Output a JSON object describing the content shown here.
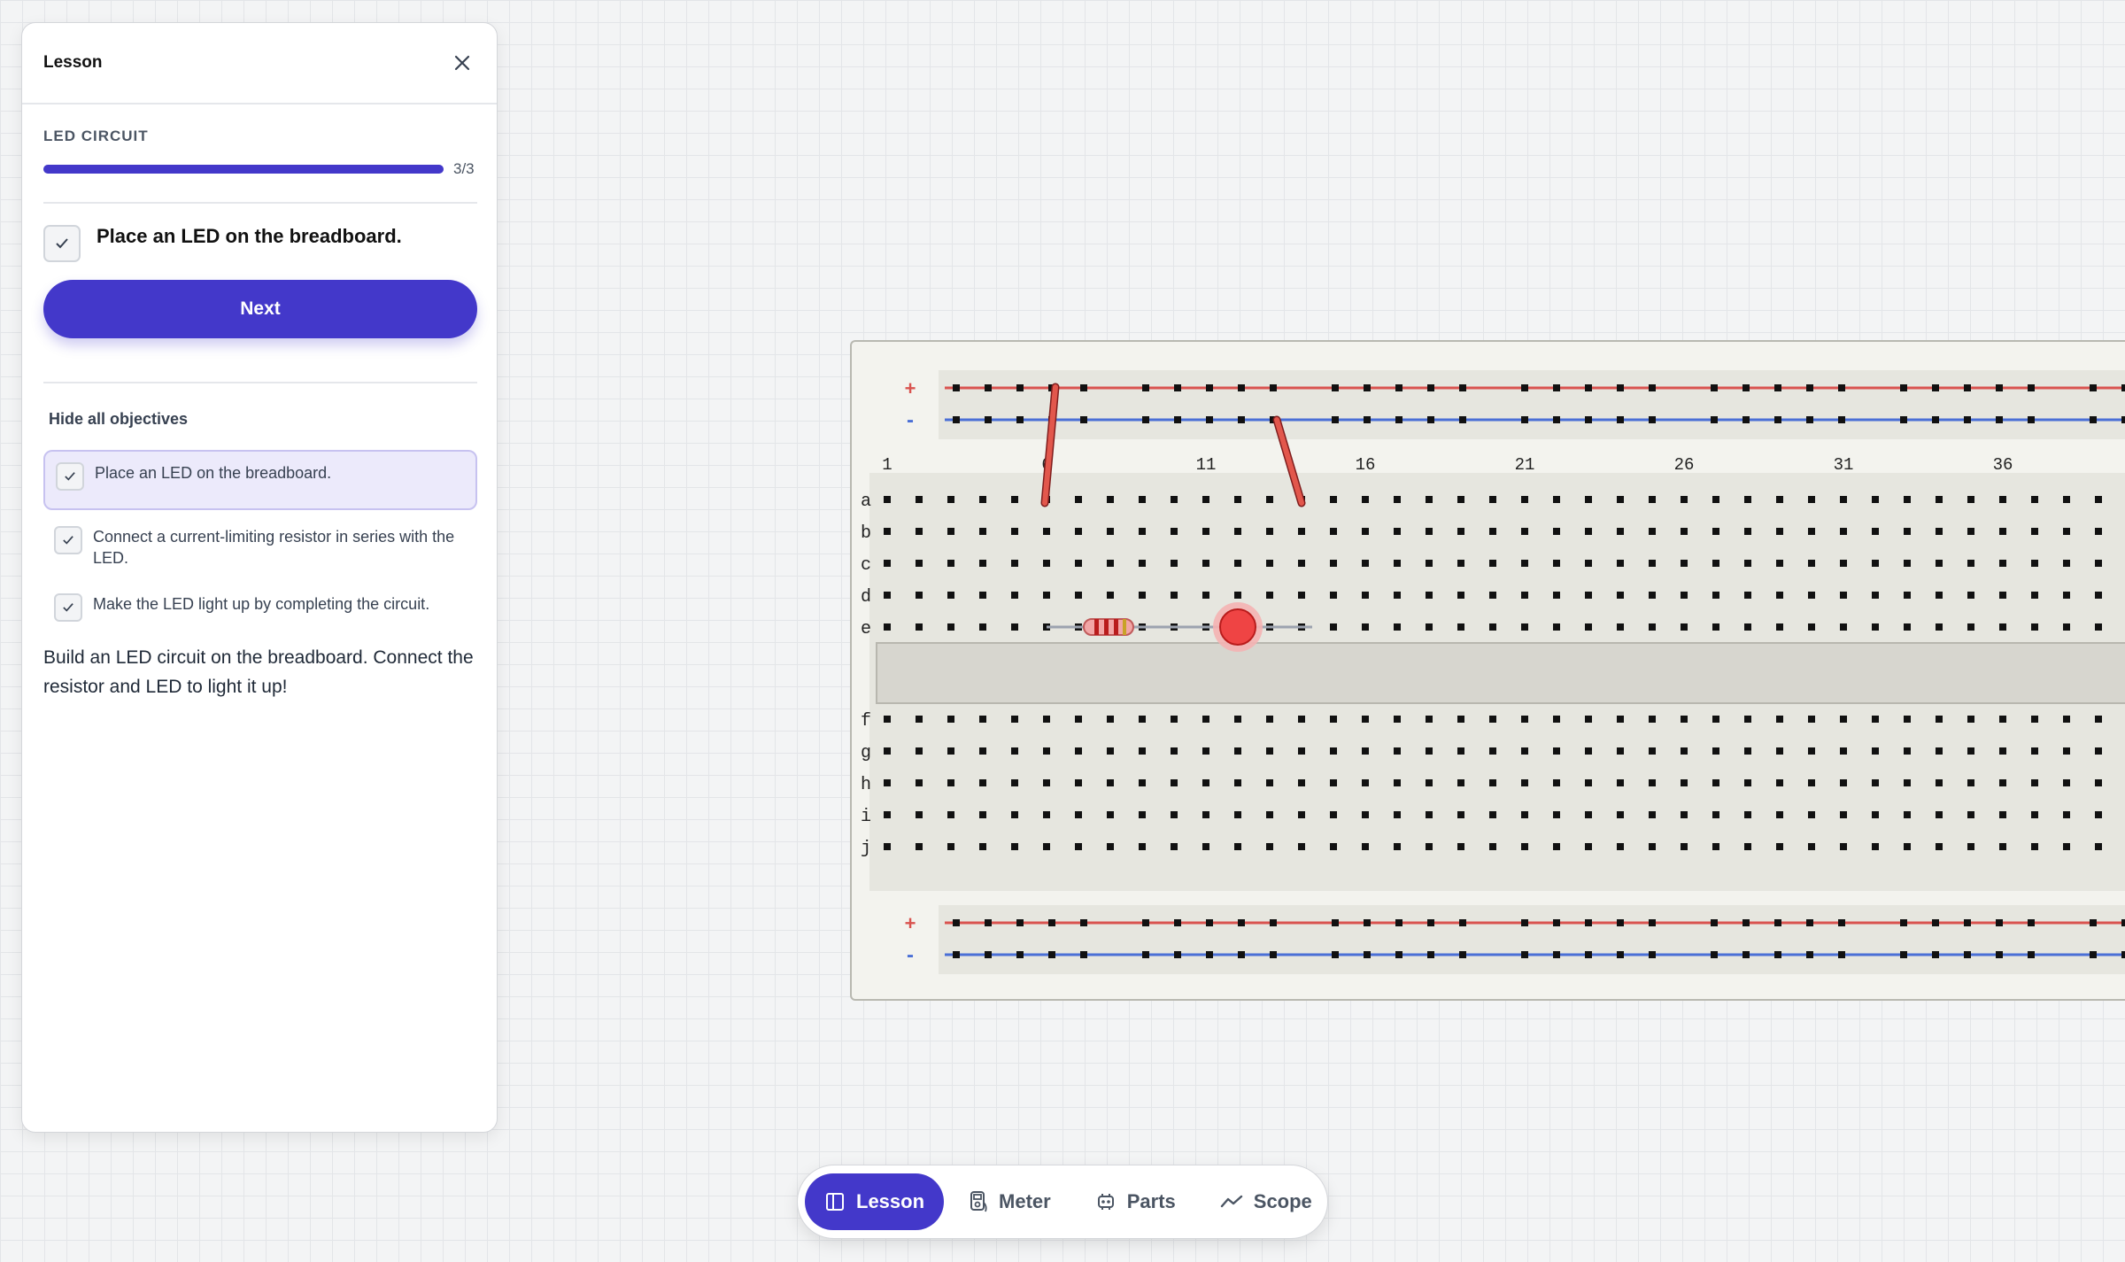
{
  "panel": {
    "title": "Lesson",
    "lesson_name": "LED CIRCUIT",
    "progress_text": "3/3",
    "progress": 1.0,
    "current_objective": "Place an LED on the breadboard.",
    "next_label": "Next",
    "hide_objectives_label": "Hide all objectives",
    "objectives": [
      {
        "label": "Place an LED on the breadboard.",
        "done": true
      },
      {
        "label": "Connect a current-limiting resistor in series with the LED.",
        "done": true
      },
      {
        "label": "Make the LED light up by completing the circuit.",
        "done": true
      }
    ],
    "description": "Build an LED circuit on the breadboard. Connect the resistor and LED to light it up!"
  },
  "breadboard": {
    "rail_plus_label": "+",
    "rail_minus_label": "-",
    "column_labels": [
      "1",
      "6",
      "11",
      "16",
      "21",
      "26",
      "31",
      "36"
    ],
    "row_labels_top": [
      "a",
      "b",
      "c",
      "d",
      "e"
    ],
    "row_labels_bottom": [
      "f",
      "g",
      "h",
      "i",
      "j"
    ]
  },
  "toolbar": {
    "items": [
      {
        "label": "Lesson",
        "icon": "book-icon",
        "active": true
      },
      {
        "label": "Meter",
        "icon": "multimeter-icon",
        "active": false
      },
      {
        "label": "Parts",
        "icon": "chip-icon",
        "active": false
      },
      {
        "label": "Scope",
        "icon": "waveform-icon",
        "active": false
      }
    ]
  },
  "colors": {
    "accent": "#4338ca",
    "rail_plus": "#d9534f",
    "rail_minus": "#4a6fd6",
    "led": "#ef4444"
  }
}
